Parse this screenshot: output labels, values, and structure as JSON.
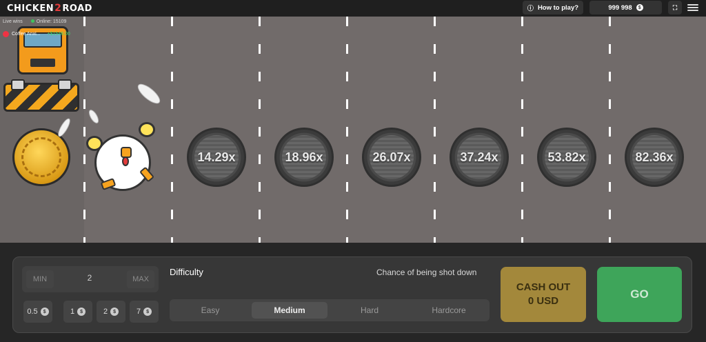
{
  "header": {
    "logo_left": "CHICKEN",
    "logo_num": "2",
    "logo_right": "ROAD",
    "how_to_play": "How to play?",
    "balance": "999 998",
    "currency_symbol": "$"
  },
  "live": {
    "label": "Live wins",
    "online": "Online: 15109",
    "last_win_user": "Coffee Anxi...",
    "last_win_amount": "+$1548.00"
  },
  "road": {
    "multipliers": [
      "14.29x",
      "18.96x",
      "26.07x",
      "37.24x",
      "53.82x",
      "82.36x"
    ]
  },
  "controls": {
    "min_label": "MIN",
    "bet_value": "2",
    "max_label": "MAX",
    "quick_bets": [
      "0.5",
      "1",
      "2",
      "7"
    ],
    "difficulty_title": "Difficulty",
    "chance_label": "Chance of being shot down",
    "difficulties": [
      "Easy",
      "Medium",
      "Hard",
      "Hardcore"
    ],
    "selected_difficulty": "Medium",
    "cashout_line1": "CASH OUT",
    "cashout_line2": "0 USD",
    "go_label": "GO"
  },
  "colors": {
    "road": "#716b6a",
    "cashout": "#a3883b",
    "go": "#3ea55a",
    "win_amount": "#3fd66a"
  }
}
